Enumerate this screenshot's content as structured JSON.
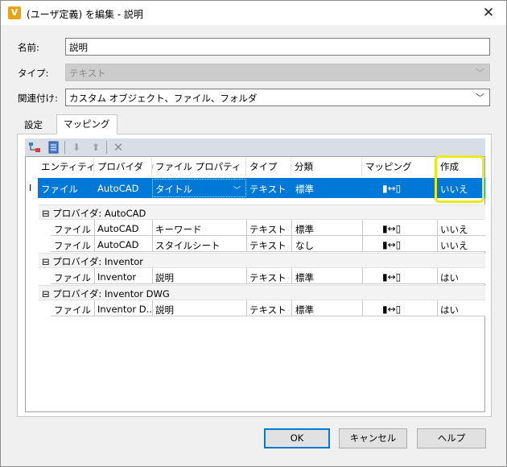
{
  "window": {
    "title": "(ユーザ定義) を編集 - 説明",
    "app_icon_letter": "V",
    "close_glyph": "✕"
  },
  "form": {
    "name_label": "名前:",
    "name_value": "説明",
    "type_label": "タイプ:",
    "type_value": "テキスト",
    "association_label": "関連付け:",
    "association_value": "カスタム オブジェクト、ファイル、フォルダ"
  },
  "tabs": [
    {
      "label": "設定",
      "active": false
    },
    {
      "label": "マッピング",
      "active": true
    }
  ],
  "toolbar": {
    "icons": [
      "add-mapping-icon",
      "import-icon",
      "move-down-icon",
      "move-up-icon",
      "delete-icon"
    ]
  },
  "grid": {
    "columns": [
      "エンティティ",
      "プロバイダ",
      "ファイル プロパティ",
      "タイプ",
      "分類",
      "マッピング",
      "作成"
    ],
    "sort_indicator": "/",
    "selected_row": {
      "entity": "ファイル",
      "provider": "AutoCAD",
      "property": "タイトル",
      "type": "テキスト",
      "category": "標準",
      "mapping": "▮↔▯",
      "create": "いいえ"
    },
    "groups": [
      {
        "label": "プロバイダ: AutoCAD",
        "expander": "⊟",
        "rows": [
          {
            "entity": "ファイル",
            "provider": "AutoCAD",
            "property": "キーワード",
            "type": "テキスト",
            "category": "標準",
            "mapping": "▮↔▯",
            "create": "いいえ"
          },
          {
            "entity": "ファイル",
            "provider": "AutoCAD",
            "property": "スタイルシート",
            "type": "テキスト",
            "category": "なし",
            "mapping": "▮↔▯",
            "create": "いいえ"
          }
        ]
      },
      {
        "label": "プロバイダ: Inventor",
        "expander": "⊟",
        "rows": [
          {
            "entity": "ファイル",
            "provider": "Inventor",
            "property": "説明",
            "type": "テキスト",
            "category": "標準",
            "mapping": "▮↔▯",
            "create": "はい"
          }
        ]
      },
      {
        "label": "プロバイダ: Inventor DWG",
        "expander": "⊟",
        "rows": [
          {
            "entity": "ファイル",
            "provider": "Inventor D...",
            "property": "説明",
            "type": "テキスト",
            "category": "標準",
            "mapping": "▮↔▯",
            "create": "はい"
          }
        ]
      }
    ]
  },
  "buttons": {
    "ok": "OK",
    "cancel": "キャンセル",
    "help": "ヘルプ"
  },
  "colors": {
    "selection": "#0078d7",
    "highlight_annotation": "#e8e81a",
    "toolbar_bg": "#d9dde6"
  }
}
